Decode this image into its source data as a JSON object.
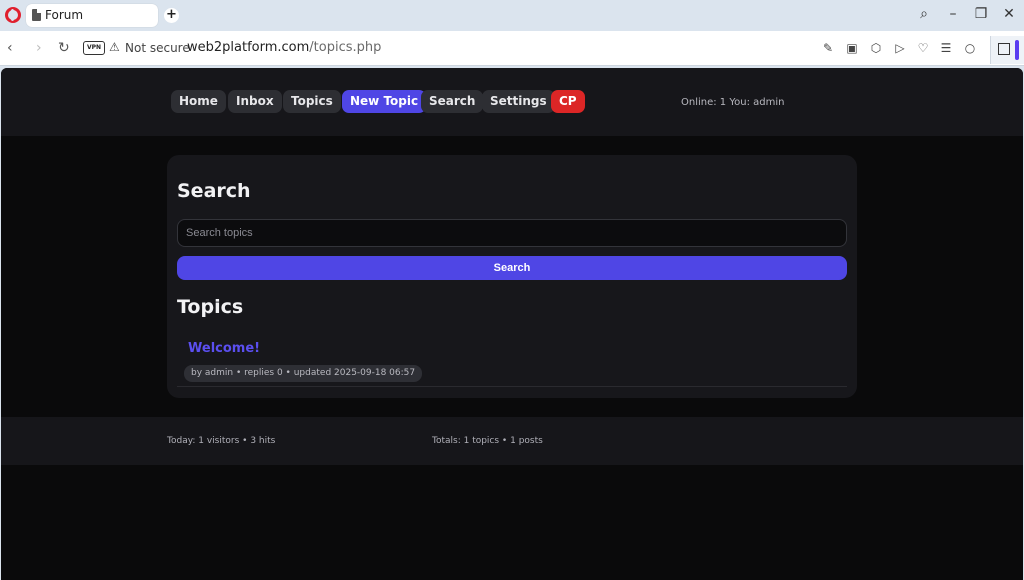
{
  "browser": {
    "tab_title": "Forum",
    "new_tab": "+",
    "vpn_label": "VPN",
    "security_text": "Not secure",
    "url_host": "web2platform.com",
    "url_path": "/topics.php"
  },
  "nav": {
    "home": "Home",
    "inbox": "Inbox",
    "topics": "Topics",
    "new_topic": "New Topic",
    "search": "Search",
    "settings": "Settings",
    "cp": "CP"
  },
  "status": {
    "online": "Online: 1 You: admin"
  },
  "search_section": {
    "heading": "Search",
    "placeholder": "Search topics",
    "button_label": "Search"
  },
  "topics_section": {
    "heading": "Topics",
    "items": [
      {
        "title": "Welcome!",
        "meta": "by admin • replies 0 • updated 2025-09-18 06:57"
      }
    ]
  },
  "footer": {
    "today": "Today: 1 visitors • 3 hits",
    "totals": "Totals: 1 topics • 1 posts"
  },
  "colors": {
    "accent": "#4f46e5",
    "danger": "#dc2626",
    "background": "#0a0a0b",
    "panel": "#17171b"
  }
}
